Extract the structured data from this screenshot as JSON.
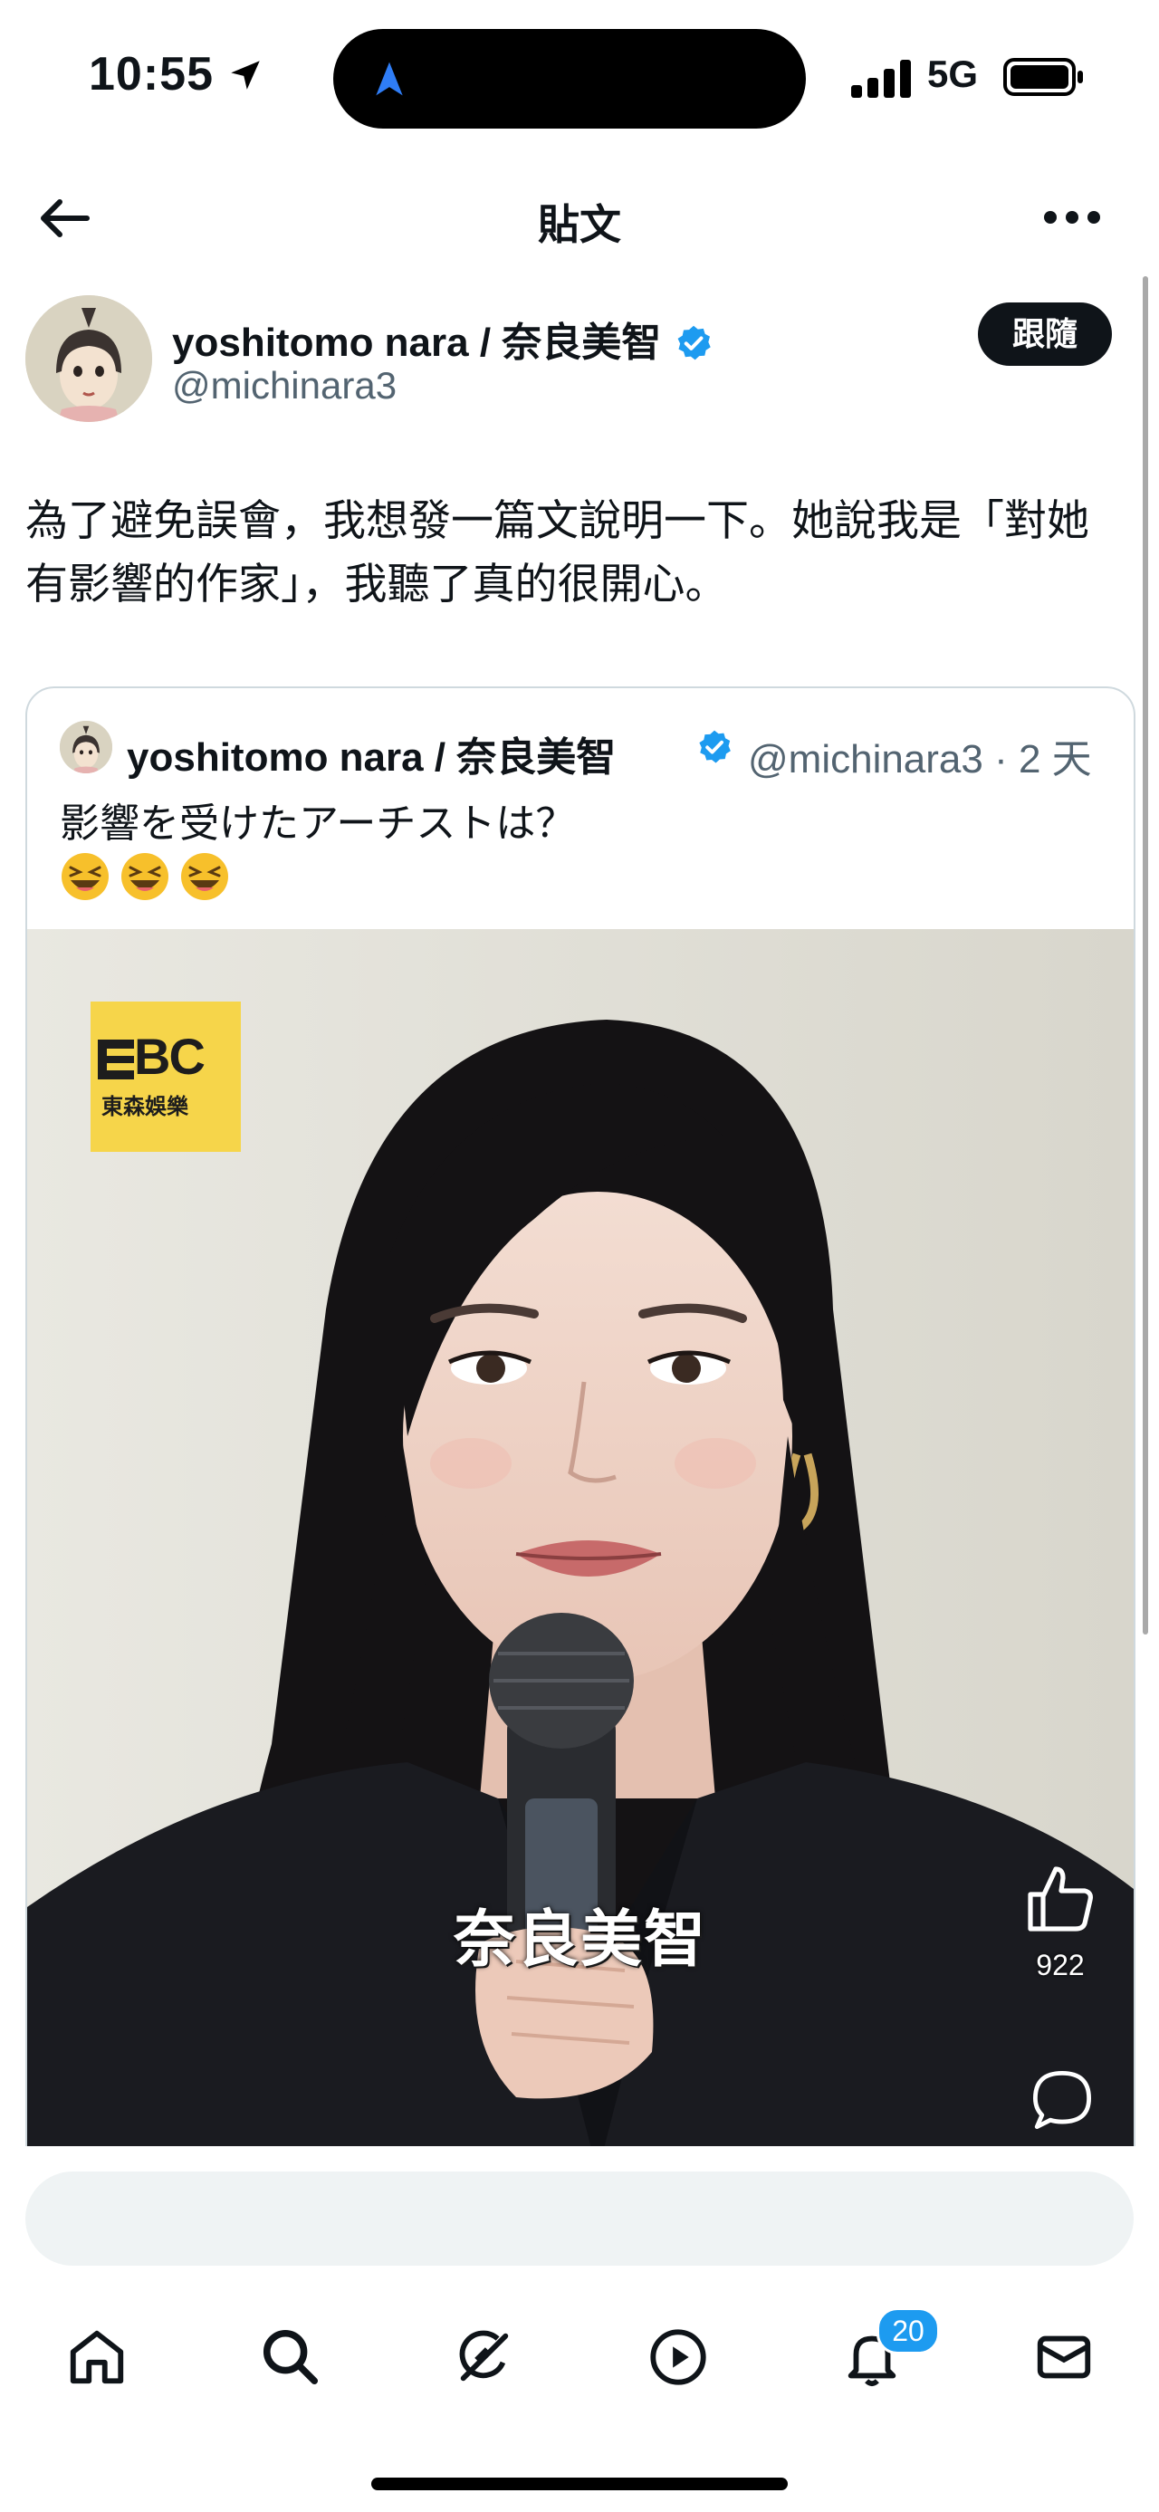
{
  "status_bar": {
    "time": "10:55",
    "network": "5G",
    "icons": [
      "location-arrow-icon",
      "signal-icon",
      "battery-icon"
    ]
  },
  "nav": {
    "title": "貼文",
    "icons": [
      "back-arrow-icon",
      "more-icon"
    ]
  },
  "post": {
    "author": {
      "display_name": "yoshitomo nara / 奈良美智",
      "handle": "@michinara3",
      "verified": true
    },
    "follow_label": "跟隨",
    "text": "為了避免誤會，我想發一篇文說明一下。她說我是「對她有影響的作家」，我聽了真的很開心。"
  },
  "quoted_post": {
    "display_name": "yoshitomo nara / 奈良美智",
    "meta": "@michinara3 · 2 天",
    "text": "影響を受けたアーチストは？",
    "emojis": [
      "laughing-emoji",
      "laughing-emoji",
      "laughing-emoji"
    ],
    "video": {
      "logo_text": "BC",
      "logo_subtext": "東森娛樂",
      "subtitle": "奈良美智",
      "like_count": "922"
    }
  },
  "reply": {
    "value": "",
    "placeholder": ""
  },
  "tab_bar": {
    "tabs": [
      "home-icon",
      "search-icon",
      "grok-icon",
      "play-icon",
      "notifications-icon",
      "messages-icon"
    ],
    "notification_count": "20"
  },
  "colors": {
    "accent": "#1d9bf0",
    "text": "#0f1419",
    "secondary_text": "#536471",
    "border": "#cfd9de",
    "logo_yellow": "#f6d54a"
  }
}
